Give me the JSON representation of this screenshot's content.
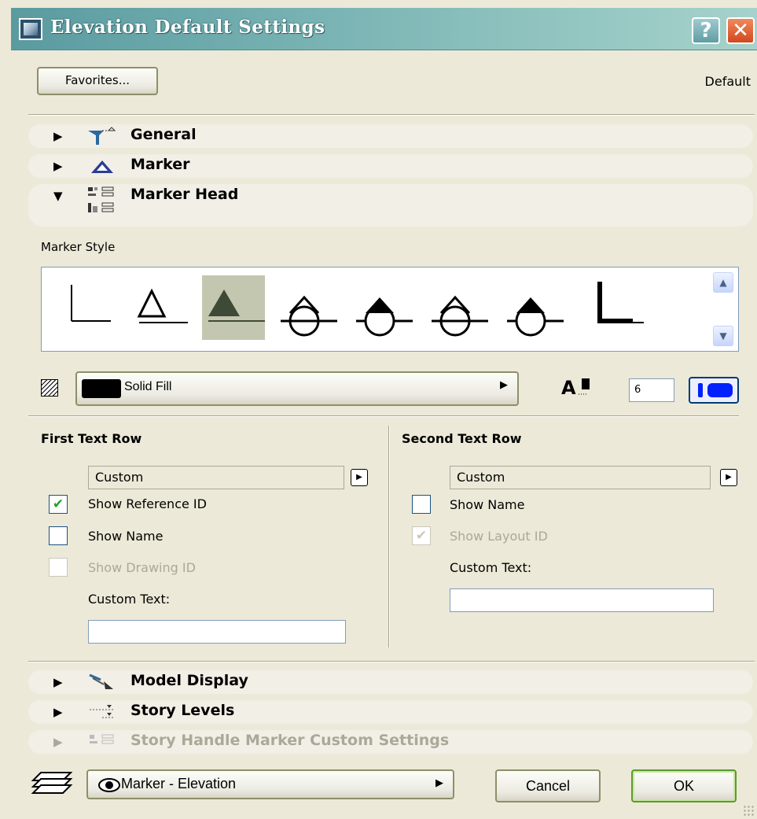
{
  "window": {
    "title": "Elevation Default Settings",
    "help_label": "?",
    "close_label": "✕"
  },
  "favorites_label": "Favorites...",
  "default_label": "Default",
  "sections": {
    "general": {
      "label": "General",
      "arrow": "▶"
    },
    "marker": {
      "label": "Marker",
      "arrow": "▶"
    },
    "marker_head": {
      "label": "Marker Head",
      "arrow": "▼"
    },
    "model_display": {
      "label": "Model Display",
      "arrow": "▶"
    },
    "story_levels": {
      "label": "Story Levels",
      "arrow": "▶"
    },
    "story_handle": {
      "label": "Story Handle Marker Custom Settings",
      "arrow": "▶"
    }
  },
  "marker_head": {
    "style_label": "Marker Style",
    "styles": [
      "corner-line",
      "triangle-outline",
      "triangle-filled",
      "circle-cross",
      "circle-half",
      "circle-cross-2",
      "circle-half-2",
      "corner-thick"
    ],
    "selected_style_index": 2,
    "fill_name": "Solid Fill",
    "fill_swatch_color": "#000000",
    "pen_icon_text": "A",
    "pen_number": "6",
    "pen_color": "#0020ff",
    "first_row": {
      "title": "First Text Row",
      "combo_value": "Custom",
      "show_reference_id": {
        "label": "Show Reference ID",
        "checked": true,
        "mark": "✔"
      },
      "show_name": {
        "label": "Show Name",
        "checked": false
      },
      "show_drawing_id": {
        "label": "Show Drawing ID",
        "checked": false,
        "disabled": true
      },
      "custom_text_label": "Custom Text:",
      "custom_text_value": ""
    },
    "second_row": {
      "title": "Second Text Row",
      "combo_value": "Custom",
      "show_name": {
        "label": "Show Name",
        "checked": false
      },
      "show_layout_id": {
        "label": "Show Layout ID",
        "checked": true,
        "disabled": true,
        "mark": "✔"
      },
      "custom_text_label": "Custom Text:",
      "custom_text_value": ""
    }
  },
  "footer": {
    "layer_value": "Marker - Elevation",
    "cancel_label": "Cancel",
    "ok_label": "OK"
  }
}
